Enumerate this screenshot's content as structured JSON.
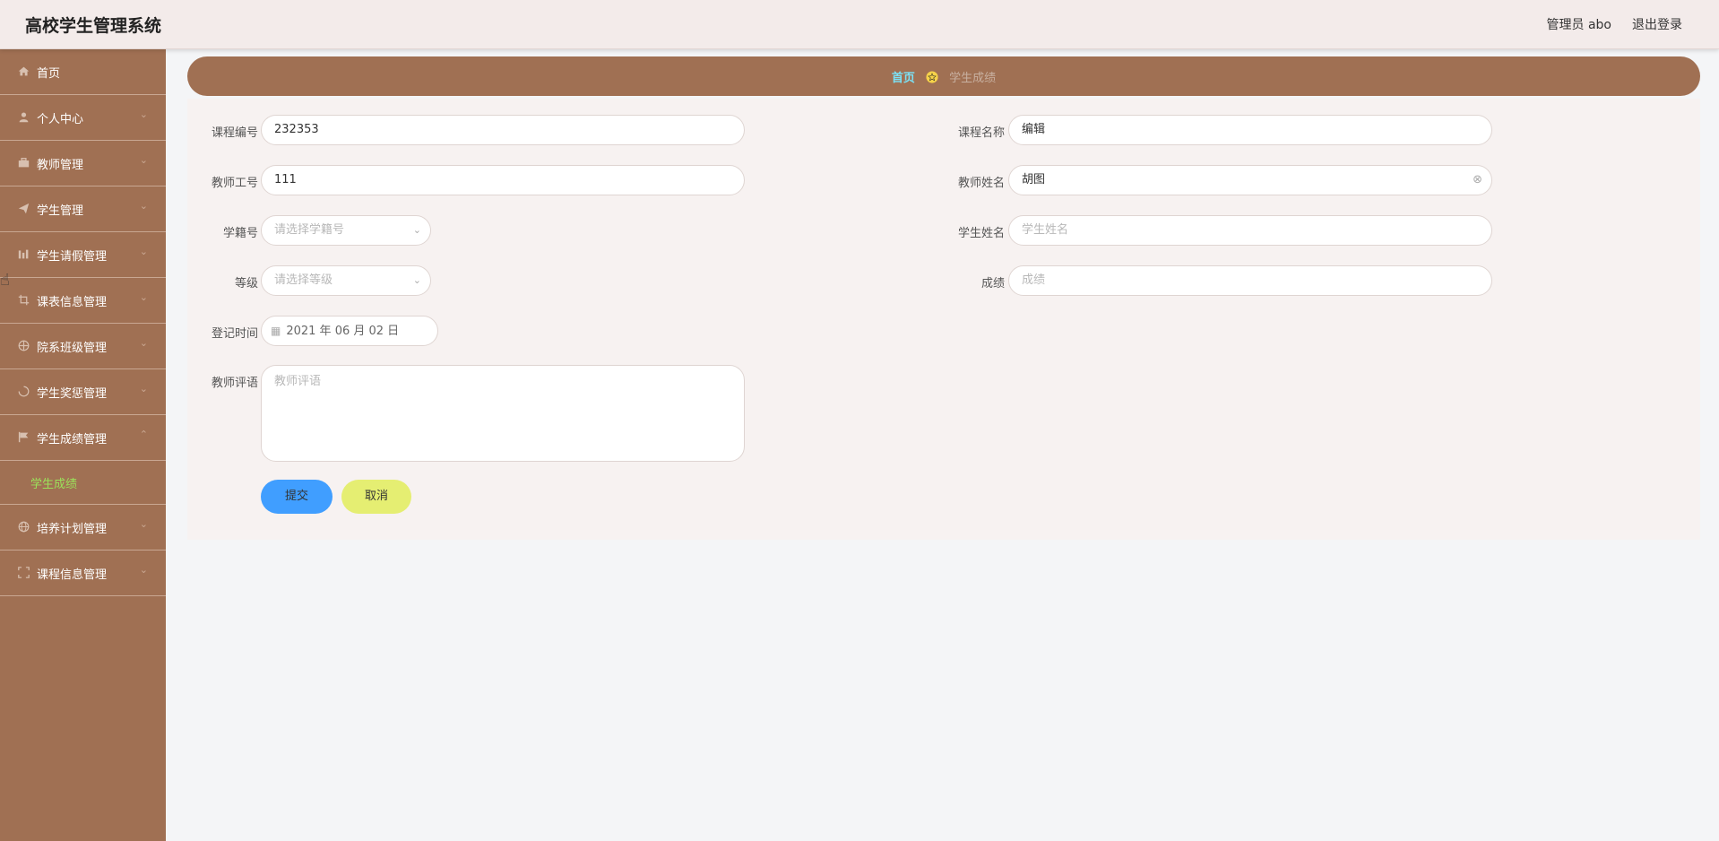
{
  "header": {
    "title": "高校学生管理系统",
    "user": "管理员 abo",
    "logout": "退出登录"
  },
  "sidebar": {
    "items": [
      {
        "label": "首页",
        "icon": "home-icon",
        "arrow": ""
      },
      {
        "label": "个人中心",
        "icon": "user-icon",
        "arrow": "⌄"
      },
      {
        "label": "教师管理",
        "icon": "briefcase-icon",
        "arrow": "⌄"
      },
      {
        "label": "学生管理",
        "icon": "send-icon",
        "arrow": "⌄"
      },
      {
        "label": "学生请假管理",
        "icon": "chart-icon",
        "arrow": "⌄"
      },
      {
        "label": "课表信息管理",
        "icon": "crop-icon",
        "arrow": "⌄"
      },
      {
        "label": "院系班级管理",
        "icon": "target-icon",
        "arrow": "⌄"
      },
      {
        "label": "学生奖惩管理",
        "icon": "loading-icon",
        "arrow": "⌄"
      },
      {
        "label": "学生成绩管理",
        "icon": "flag-icon",
        "arrow": "⌃"
      },
      {
        "label": "培养计划管理",
        "icon": "globe-icon",
        "arrow": "⌄"
      },
      {
        "label": "课程信息管理",
        "icon": "fullscreen-icon",
        "arrow": "⌄"
      }
    ],
    "active_sub": "学生成绩"
  },
  "breadcrumb": {
    "home": "首页",
    "current": "学生成绩"
  },
  "form": {
    "course_no": {
      "label": "课程编号",
      "value": "232353"
    },
    "course_name": {
      "label": "课程名称",
      "value": "编辑"
    },
    "teacher_id": {
      "label": "教师工号",
      "value": "111"
    },
    "teacher_name": {
      "label": "教师姓名",
      "value": "胡图"
    },
    "student_no": {
      "label": "学籍号",
      "placeholder": "请选择学籍号"
    },
    "student_name": {
      "label": "学生姓名",
      "placeholder": "学生姓名"
    },
    "grade_level": {
      "label": "等级",
      "placeholder": "请选择等级"
    },
    "score": {
      "label": "成绩",
      "placeholder": "成绩"
    },
    "reg_time": {
      "label": "登记时间",
      "value": "2021 年 06 月 02 日"
    },
    "comment": {
      "label": "教师评语",
      "placeholder": "教师评语"
    },
    "submit": "提交",
    "cancel": "取消"
  },
  "colors": {
    "sidebar": "#a07053",
    "active_sub": "#9be25a",
    "breadcrumb_home": "#7be1f5",
    "submit": "#409eff",
    "cancel": "#e5ee72"
  }
}
